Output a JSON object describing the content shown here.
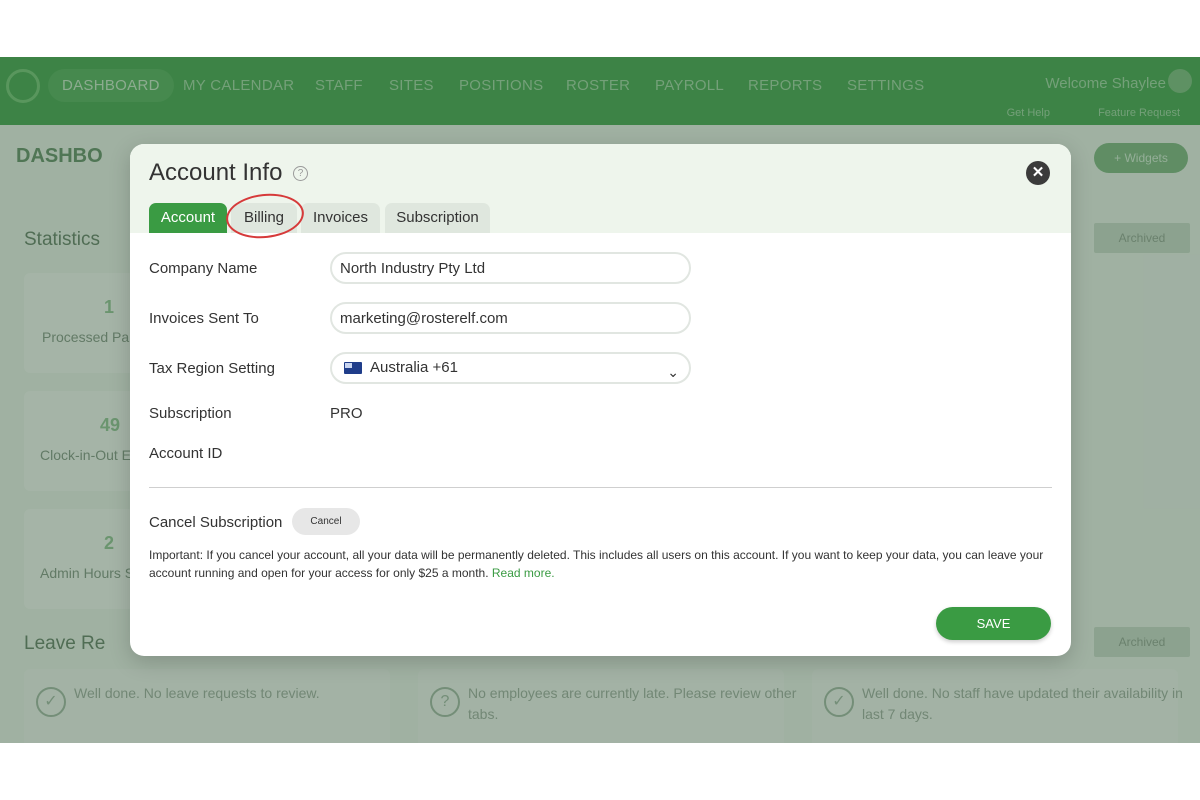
{
  "nav": {
    "items": [
      "DASHBOARD",
      "MY CALENDAR",
      "STAFF",
      "SITES",
      "POSITIONS",
      "ROSTER",
      "PAYROLL",
      "REPORTS",
      "SETTINGS"
    ],
    "welcome": "Welcome Shaylee",
    "get_help": "Get Help",
    "feature_request": "Feature Request"
  },
  "background": {
    "page_title": "DASHBO",
    "widgets_button": "+ Widgets",
    "statistics_title": "Statistics",
    "stats": [
      {
        "value": "1",
        "label": "Processed Pa"
      },
      {
        "value": "49",
        "label": "Clock-in-Out E"
      },
      {
        "value": "2",
        "label": "Admin Hours S"
      }
    ],
    "archived": "Archived",
    "leave_title": "Leave Re",
    "cards": [
      {
        "text": "Well done. No leave requests to review."
      },
      {
        "text": "No employees are currently late. Please review other tabs."
      },
      {
        "text": "Well done. No staff have updated their availability in last 7 days."
      }
    ]
  },
  "modal": {
    "title": "Account Info",
    "tabs": [
      "Account",
      "Billing",
      "Invoices",
      "Subscription"
    ],
    "active_tab": "Account",
    "fields": {
      "company_name_label": "Company Name",
      "company_name_value": "North Industry Pty Ltd",
      "invoices_sent_to_label": "Invoices Sent To",
      "invoices_sent_to_value": "marketing@rosterelf.com",
      "tax_region_label": "Tax Region Setting",
      "tax_region_value": "Australia +61",
      "subscription_label": "Subscription",
      "subscription_value": "PRO",
      "account_id_label": "Account ID",
      "account_id_value": ""
    },
    "cancel_subscription_label": "Cancel Subscription",
    "cancel_button": "Cancel",
    "important_text": "Important: If you cancel your account, all your data will be permanently deleted. This includes all users on this account. If you want to keep your data, you can leave your account running and open for your access for only $25 a month.",
    "read_more": "Read more.",
    "save_button": "SAVE"
  },
  "colors": {
    "brand_green": "#3a9b43",
    "annotation_red": "#d63a3a"
  }
}
